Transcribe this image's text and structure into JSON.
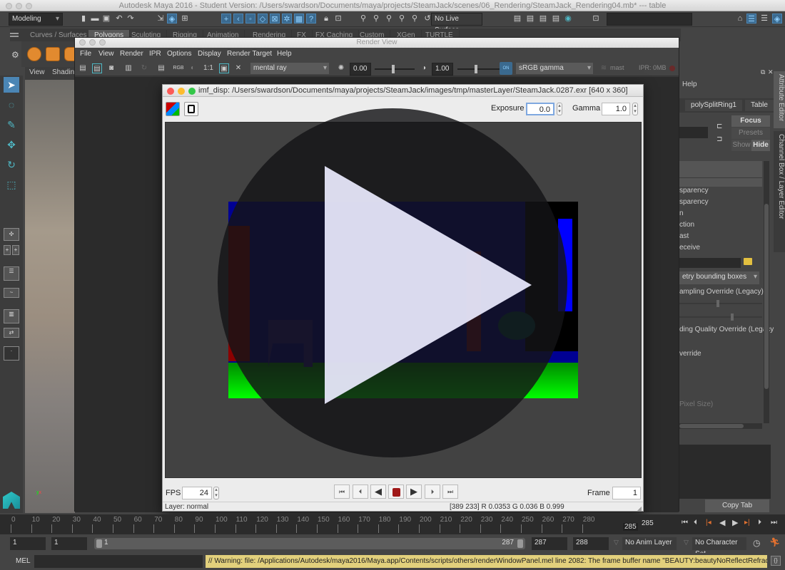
{
  "app": {
    "title": "Autodesk Maya 2016 - Student Version: /Users/swardson/Documents/maya/projects/SteamJack/scenes/06_Rendering/SteamJack_Rendering04.mb*   ---   table"
  },
  "toolbar": {
    "menu_set": "Modeling",
    "live_surface": "No Live Surface",
    "icons": [
      "new-scene-icon",
      "open-scene-icon",
      "save-scene-icon",
      "undo-icon",
      "redo-icon",
      "select-hierarchy-icon",
      "select-object-icon",
      "select-component-icon",
      "snap-grid-icon",
      "snap-curve-icon",
      "snap-point-icon",
      "snap-view-plane-icon",
      "snap-projected-center-icon",
      "make-live-icon",
      "help-icon",
      "lock-icon",
      "render-current-frame-icon",
      "render-sequence-icon",
      "ipr-render-icon",
      "render-settings-icon",
      "hypershade-icon",
      "panel-layout-icons"
    ]
  },
  "shelf": {
    "tabs": [
      "Curves / Surfaces",
      "Polygons",
      "Sculpting",
      "Rigging",
      "Animation",
      "Rendering",
      "FX",
      "FX Caching",
      "Custom",
      "XGen",
      "TURTLE"
    ],
    "active_tab": "Polygons"
  },
  "viewport": {
    "menu": [
      "View",
      "Shading"
    ]
  },
  "render_view": {
    "title": "Render View",
    "menu": [
      "File",
      "View",
      "Render",
      "IPR",
      "Options",
      "Display",
      "Render Target",
      "Help"
    ],
    "ratio_label": "1:1",
    "rgb_label": "RGB",
    "renderer": "mental ray",
    "exposure_value": "0.00",
    "gamma_value": "1.00",
    "color_mgmt_label": "ON",
    "color_space": "sRGB gamma",
    "layer_label": "mast",
    "ipr_memory": "IPR: 0MB"
  },
  "imf_disp": {
    "title": "imf_disp: /Users/swardson/Documents/maya/projects/SteamJack/images/tmp/masterLayer/SteamJack.0287.exr [640 x 360]",
    "exposure_label": "Exposure",
    "exposure_value": "0.0",
    "gamma_label": "Gamma",
    "gamma_value": "1.0",
    "fps_label": "FPS",
    "fps_value": "24",
    "frame_label": "Frame",
    "frame_value": "1",
    "status_layer": "Layer: normal",
    "status_pixel": "[389 233]  R 0.0353  G 0.036  B 0.999",
    "colors": {
      "blue": "#000093",
      "green": "#00ff00",
      "red": "#8b0000"
    }
  },
  "attribute_editor": {
    "help_menu": "Help",
    "tabs": [
      "polySplitRing1",
      "Table"
    ],
    "focus_button": "Focus",
    "presets_button": "Presets",
    "show_button": "Show",
    "hide_button": "Hide",
    "rows": [
      "sparency",
      "sparency",
      "n",
      "ction",
      "ast",
      "eceive"
    ],
    "dropdown_value": "etry bounding boxes",
    "labels": [
      "ampling Override (Legacy)",
      "ding Quality Override (Legacy",
      "verride",
      "Pixel Size)"
    ],
    "copy_tab_button": "Copy Tab",
    "side_tabs": [
      "Attribute Editor",
      "Channel Box / Layer Editor"
    ]
  },
  "timeline": {
    "ticks": [
      "0",
      "10",
      "20",
      "30",
      "40",
      "50",
      "60",
      "70",
      "80",
      "90",
      "100",
      "110",
      "120",
      "130",
      "140",
      "150",
      "160",
      "170",
      "180",
      "190",
      "200",
      "210",
      "220",
      "230",
      "240",
      "250",
      "260",
      "270",
      "280"
    ],
    "current_frame_marker": "285",
    "current_frame": "285"
  },
  "range": {
    "start_field": "1",
    "anim_start": "1",
    "slider_start": "1",
    "slider_end": "287",
    "anim_end": "287",
    "end_field": "288",
    "anim_layer": "No Anim Layer",
    "character_set": "No Character Set"
  },
  "command_line": {
    "label": "MEL",
    "input_value": "",
    "warning": "// Warning: file: /Applications/Autodesk/maya2016/Maya.app/Contents/scripts/others/renderWindowPanel.mel line 2082: The frame buffer name \"BEAUTY:beautyNoReflectRefract.shot_cam\""
  }
}
